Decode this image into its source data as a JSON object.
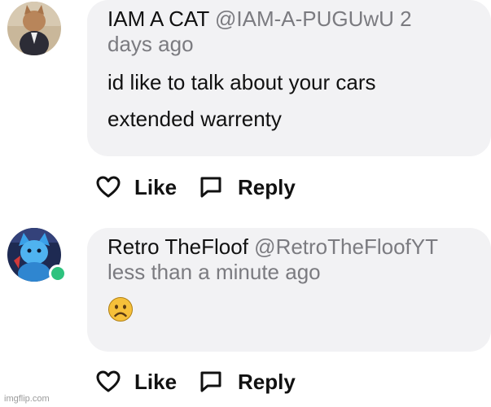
{
  "comments": [
    {
      "author": "IAM A CAT",
      "handle": "@IAM-A-PUGUwU",
      "time_first": "2",
      "time_rest": "days ago",
      "lines": [
        "id like to talk about your cars",
        "extended warrenty"
      ],
      "like_label": "Like",
      "reply_label": "Reply"
    },
    {
      "author": "Retro TheFloof",
      "handle": "@RetroTheFloofYT",
      "time": "less than a minute ago",
      "emoji_icon": "frowning-face-icon",
      "like_label": "Like",
      "reply_label": "Reply"
    }
  ],
  "watermark": "imgflip.com",
  "colors": {
    "bubble": "#f2f2f4",
    "muted_text": "#7b7b80",
    "online": "#2ec27e",
    "emoji": "#f6c03a"
  }
}
